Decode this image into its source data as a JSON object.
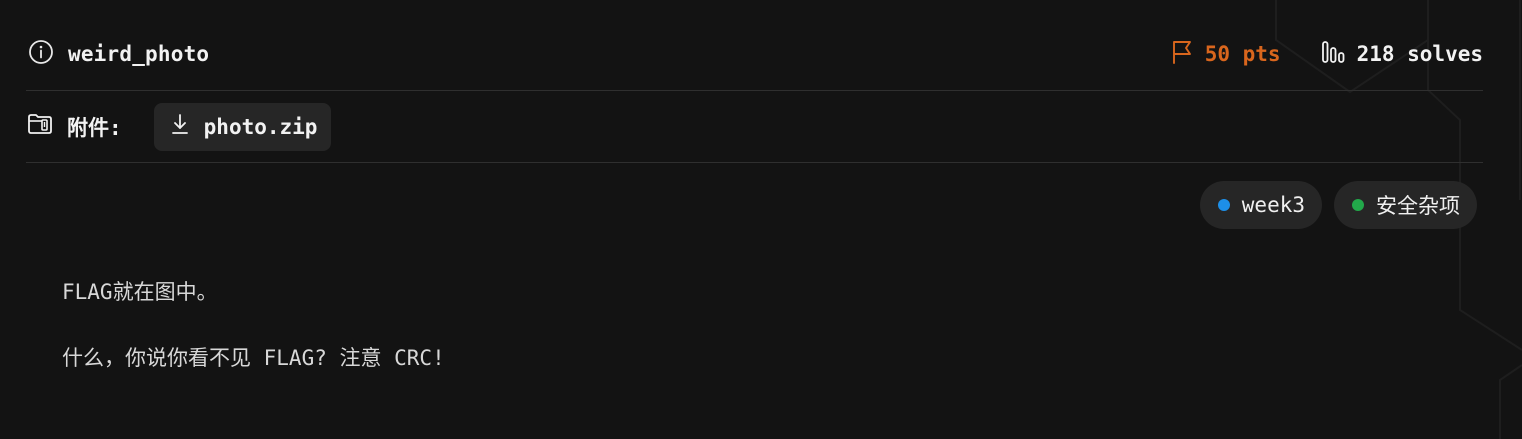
{
  "challenge": {
    "name": "weird_photo",
    "points": "50 pts",
    "solves": "218 solves"
  },
  "attachments": {
    "label": "附件:",
    "files": [
      {
        "name": "photo.zip"
      }
    ]
  },
  "tags": [
    {
      "label": "week3",
      "color": "#1d8fe8"
    },
    {
      "label": "安全杂项",
      "color": "#22a84a"
    }
  ],
  "description": [
    "FLAG就在图中。",
    "什么，你说你看不见 FLAG? 注意 CRC!"
  ],
  "colors": {
    "background": "#131313",
    "points": "#d9661d",
    "divider": "#2f2f2f"
  }
}
